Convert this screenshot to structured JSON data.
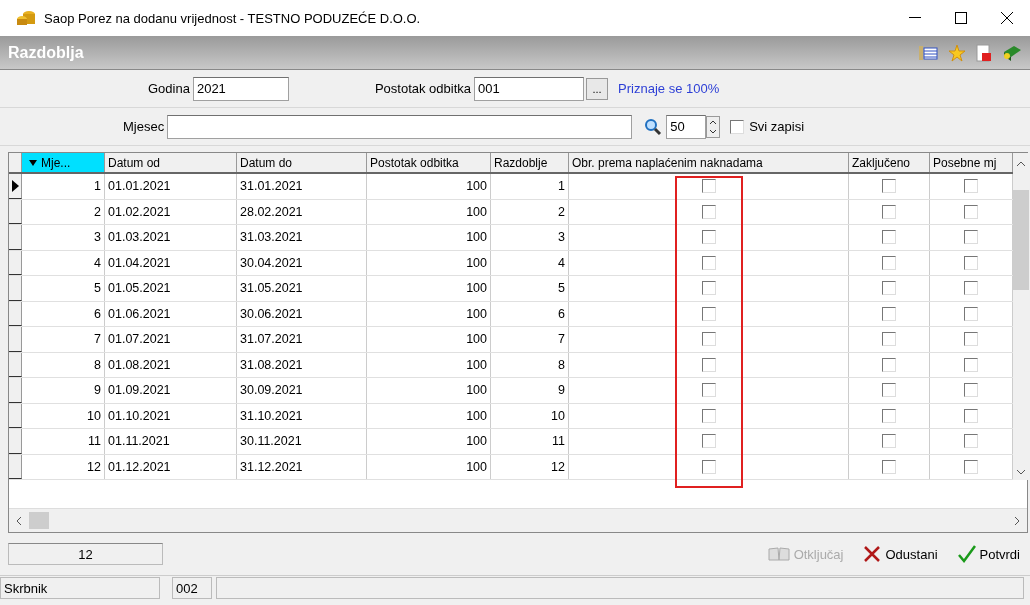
{
  "window": {
    "title": "Saop Porez na dodanu vrijednost - TESTNO PODUZEĆE D.O.O."
  },
  "panel": {
    "title": "Razdoblja"
  },
  "filters": {
    "godina_label": "Godina",
    "godina": "2021",
    "postotak_label": "Postotak odbitka",
    "postotak": "001",
    "browse": "...",
    "postotak_note": "Priznaje se 100%",
    "mjesec_label": "Mjesec",
    "page_size": "50",
    "all_records_label": "Svi zapisi",
    "all_records": false
  },
  "table": {
    "columns": [
      {
        "label": "Mje...",
        "sorted": true,
        "highlighted": false
      },
      {
        "label": "Datum od",
        "sorted": false,
        "highlighted": false
      },
      {
        "label": "Datum do",
        "sorted": false,
        "highlighted": false
      },
      {
        "label": "Postotak odbitka",
        "sorted": false,
        "highlighted": false
      },
      {
        "label": "Razdoblje",
        "sorted": false,
        "highlighted": false
      },
      {
        "label": "Obr. prema naplaćenim naknadama",
        "sorted": false,
        "highlighted": true
      },
      {
        "label": "Zaključeno",
        "sorted": false,
        "highlighted": false
      },
      {
        "label": "Posebne mj",
        "sorted": false,
        "highlighted": false
      }
    ],
    "rows": [
      {
        "selected": true,
        "cells": [
          "1",
          "01.01.2021",
          "31.01.2021",
          "100",
          "1"
        ],
        "checks": [
          false,
          false,
          false
        ]
      },
      {
        "selected": false,
        "cells": [
          "2",
          "01.02.2021",
          "28.02.2021",
          "100",
          "2"
        ],
        "checks": [
          false,
          false,
          false
        ]
      },
      {
        "selected": false,
        "cells": [
          "3",
          "01.03.2021",
          "31.03.2021",
          "100",
          "3"
        ],
        "checks": [
          false,
          false,
          false
        ]
      },
      {
        "selected": false,
        "cells": [
          "4",
          "01.04.2021",
          "30.04.2021",
          "100",
          "4"
        ],
        "checks": [
          false,
          false,
          false
        ]
      },
      {
        "selected": false,
        "cells": [
          "5",
          "01.05.2021",
          "31.05.2021",
          "100",
          "5"
        ],
        "checks": [
          false,
          false,
          false
        ]
      },
      {
        "selected": false,
        "cells": [
          "6",
          "01.06.2021",
          "30.06.2021",
          "100",
          "6"
        ],
        "checks": [
          false,
          false,
          false
        ]
      },
      {
        "selected": false,
        "cells": [
          "7",
          "01.07.2021",
          "31.07.2021",
          "100",
          "7"
        ],
        "checks": [
          false,
          false,
          false
        ]
      },
      {
        "selected": false,
        "cells": [
          "8",
          "01.08.2021",
          "31.08.2021",
          "100",
          "8"
        ],
        "checks": [
          false,
          false,
          false
        ]
      },
      {
        "selected": false,
        "cells": [
          "9",
          "01.09.2021",
          "30.09.2021",
          "100",
          "9"
        ],
        "checks": [
          false,
          false,
          false
        ]
      },
      {
        "selected": false,
        "cells": [
          "10",
          "01.10.2021",
          "31.10.2021",
          "100",
          "10"
        ],
        "checks": [
          false,
          false,
          false
        ]
      },
      {
        "selected": false,
        "cells": [
          "11",
          "01.11.2021",
          "30.11.2021",
          "100",
          "11"
        ],
        "checks": [
          false,
          false,
          false
        ]
      },
      {
        "selected": false,
        "cells": [
          "12",
          "01.12.2021",
          "31.12.2021",
          "100",
          "12"
        ],
        "checks": [
          false,
          false,
          false
        ]
      }
    ]
  },
  "record_count": "12",
  "buttons": [
    {
      "kind": "unlock",
      "label": "Otključaj",
      "disabled": true
    },
    {
      "kind": "cancel",
      "label": "Odustani",
      "disabled": false
    },
    {
      "kind": "confirm",
      "label": "Potvrdi",
      "disabled": false
    }
  ],
  "status_bar": {
    "user": "Skrbnik",
    "code": "002"
  }
}
